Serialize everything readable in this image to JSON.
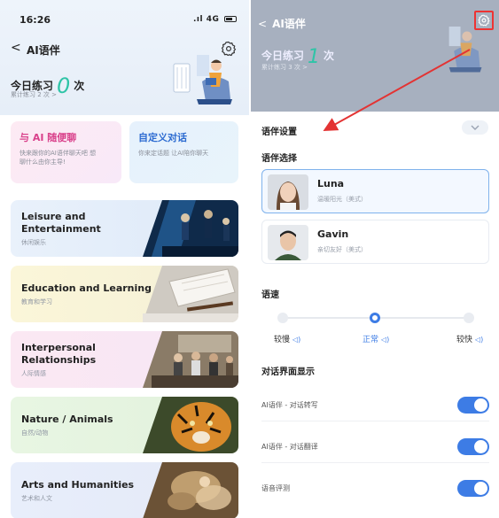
{
  "left": {
    "status": {
      "time": "16:26",
      "signal": "4G"
    },
    "nav": {
      "back": "<",
      "title": "AI语伴"
    },
    "today": {
      "label": "今日练习",
      "count": "0",
      "unit": "次"
    },
    "total": "累计练习 2 次 >",
    "quick": [
      {
        "title": "与 AI 随便聊",
        "desc": "快来跟你的AI语伴聊天吧 想聊什么由你主导!"
      },
      {
        "title": "自定义对话",
        "desc": "你来定话题 让AI陪你聊天"
      }
    ],
    "categories": [
      {
        "en": "Leisure and Entertainment",
        "cn": "休闲娱乐"
      },
      {
        "en": "Education and Learning",
        "cn": "教育和学习"
      },
      {
        "en": "Interpersonal Relationships",
        "cn": "人际情感"
      },
      {
        "en": "Nature / Animals",
        "cn": "自然/动物"
      },
      {
        "en": "Arts and Humanities",
        "cn": "艺术和人文"
      }
    ]
  },
  "right": {
    "nav": {
      "back": "<",
      "title": "AI语伴"
    },
    "today": {
      "label": "今日练习",
      "count": "1",
      "unit": "次"
    },
    "total": "累计练习 3 次 >",
    "sheet_title": "语伴设置",
    "voice_section": "语伴选择",
    "voices": [
      {
        "name": "Luna",
        "desc": "温暖阳光（美式）"
      },
      {
        "name": "Gavin",
        "desc": "亲切友好（美式）"
      }
    ],
    "speed_section": "语速",
    "speeds": [
      "较慢",
      "正常",
      "较快"
    ],
    "speed_selected": 1,
    "display_section": "对话界面显示",
    "toggles": [
      {
        "label": "AI语伴 - 对话转写",
        "on": true
      },
      {
        "label": "AI语伴 - 对话翻译",
        "on": true
      },
      {
        "label": "语音评测",
        "on": true
      }
    ]
  },
  "colors": {
    "accent": "#3d7ce5",
    "count": "#2fc4a7",
    "annotation": "#e33333"
  },
  "icons": [
    "back-chevron-icon",
    "gear-icon",
    "speaker-icon",
    "chevron-down-icon"
  ]
}
